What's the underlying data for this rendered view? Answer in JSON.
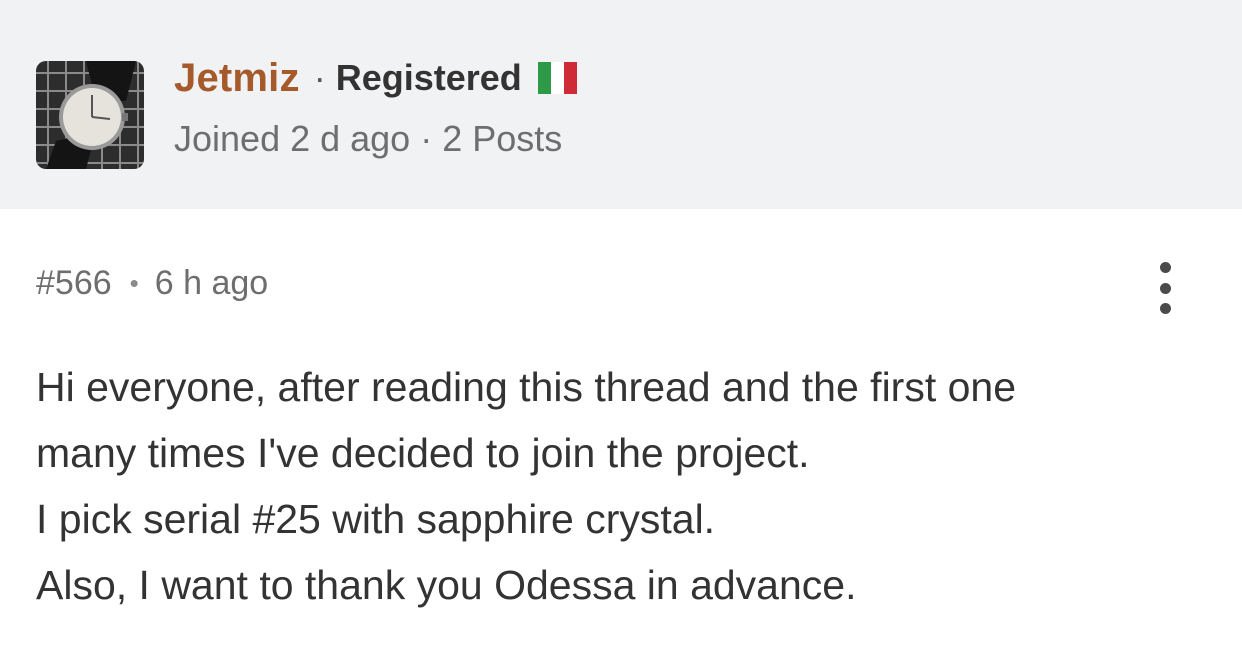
{
  "author": {
    "name": "Jetmiz",
    "separator": "·",
    "role": "Registered",
    "flag_colors": [
      "#2e9a48",
      "#ffffff",
      "#cf2b37"
    ],
    "meta": "Joined 2 d ago · 2 Posts"
  },
  "post": {
    "number": "#566",
    "bullet": "•",
    "time": "6 h ago",
    "body_lines": [
      "Hi everyone, after reading this thread and the first one",
      "many times I've decided to join the project.",
      "I pick serial #25 with sapphire crystal.",
      "Also, I want to thank you Odessa in advance."
    ]
  },
  "icons": {
    "more_menu": "vertical-ellipsis-icon",
    "flag": "italy-flag-icon"
  }
}
